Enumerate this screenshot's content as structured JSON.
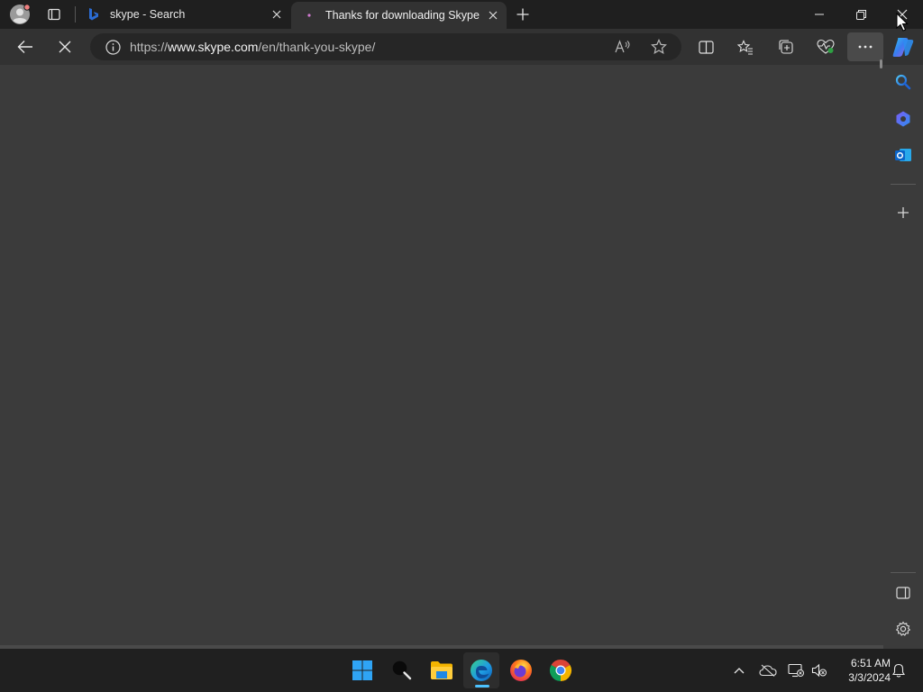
{
  "browser": {
    "tabs": [
      {
        "title": "skype - Search",
        "favicon": "bing-icon",
        "active": false
      },
      {
        "title": "Thanks for downloading Skype",
        "favicon": "loading-dot-icon",
        "active": true
      }
    ],
    "address": {
      "prefix": "https://",
      "domain": "www.skype.com",
      "path": "/en/thank-you-skype/"
    }
  },
  "taskbar": {
    "time": "6:51 AM",
    "date": "3/3/2024"
  },
  "colors": {
    "titlebar": "#1f1f1f",
    "toolbar": "#323232",
    "content": "#3b3b3b",
    "taskbar": "#202020",
    "accent": "#0078d4"
  }
}
